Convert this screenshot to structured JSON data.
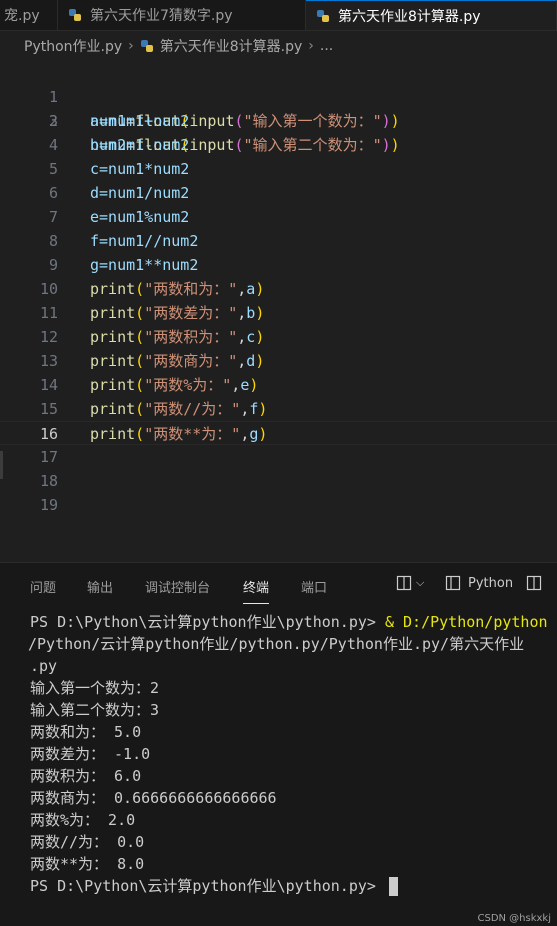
{
  "tabs": [
    {
      "label": "宠.py"
    },
    {
      "label": "第六天作业7猜数字.py"
    },
    {
      "label": "第六天作业8计算器.py"
    }
  ],
  "breadcrumb": {
    "folder": "Python作业.py",
    "file": "第六天作业8计算器.py",
    "more": "..."
  },
  "editor": {
    "line_numbers": [
      "1",
      "2",
      "3",
      "4",
      "5",
      "6",
      "7",
      "8",
      "9",
      "10",
      "11",
      "12",
      "13",
      "14",
      "15",
      "16",
      "17",
      "18",
      "19"
    ],
    "current_line": 16,
    "lines": [
      {
        "var": "num1",
        "fn1": "float",
        "fn2": "input",
        "str": "\"输入第一个数为：\""
      },
      {
        "var": "num2",
        "fn1": "float",
        "fn2": "input",
        "str": "\"输入第二个数为：\""
      },
      {
        "text": "a=num1+num2"
      },
      {
        "text": "b=num1-num2"
      },
      {
        "text": "c=num1*num2"
      },
      {
        "text": "d=num1/num2"
      },
      {
        "text": "e=num1%num2"
      },
      {
        "text": "f=num1//num2"
      },
      {
        "text": "g=num1**num2"
      },
      {
        "fn": "print",
        "str": "\"两数和为：\"",
        "arg": "a"
      },
      {
        "fn": "print",
        "str": "\"两数差为：\"",
        "arg": "b"
      },
      {
        "fn": "print",
        "str": "\"两数积为：\"",
        "arg": "c"
      },
      {
        "fn": "print",
        "str": "\"两数商为：\"",
        "arg": "d"
      },
      {
        "fn": "print",
        "str": "\"两数%为：\"",
        "arg": "e"
      },
      {
        "fn": "print",
        "str": "\"两数//为：\"",
        "arg": "f"
      },
      {
        "fn": "print",
        "str": "\"两数**为：\"",
        "arg": "g"
      }
    ]
  },
  "panel": {
    "tabs": [
      "问题",
      "输出",
      "调试控制台",
      "终端",
      "端口"
    ],
    "active_tab": "终端",
    "shell_label": "Python"
  },
  "terminal": {
    "prompt1": "PS D:\\Python\\云计算python作业\\python.py> ",
    "command": "& D:/Python/python",
    "wrap1": "/Python/云计算python作业/python.py/Python作业.py/第六天作业",
    "wrap2": ".py",
    "output": [
      "输入第一个数为：2",
      "输入第二个数为：3",
      "两数和为： 5.0",
      "两数差为： -1.0",
      "两数积为： 6.0",
      "两数商为： 0.6666666666666666",
      "两数%为： 2.0",
      "两数//为： 0.0",
      "两数**为： 8.0"
    ],
    "prompt2": "PS D:\\Python\\云计算python作业\\python.py> "
  },
  "watermark": "CSDN @hskxkj"
}
